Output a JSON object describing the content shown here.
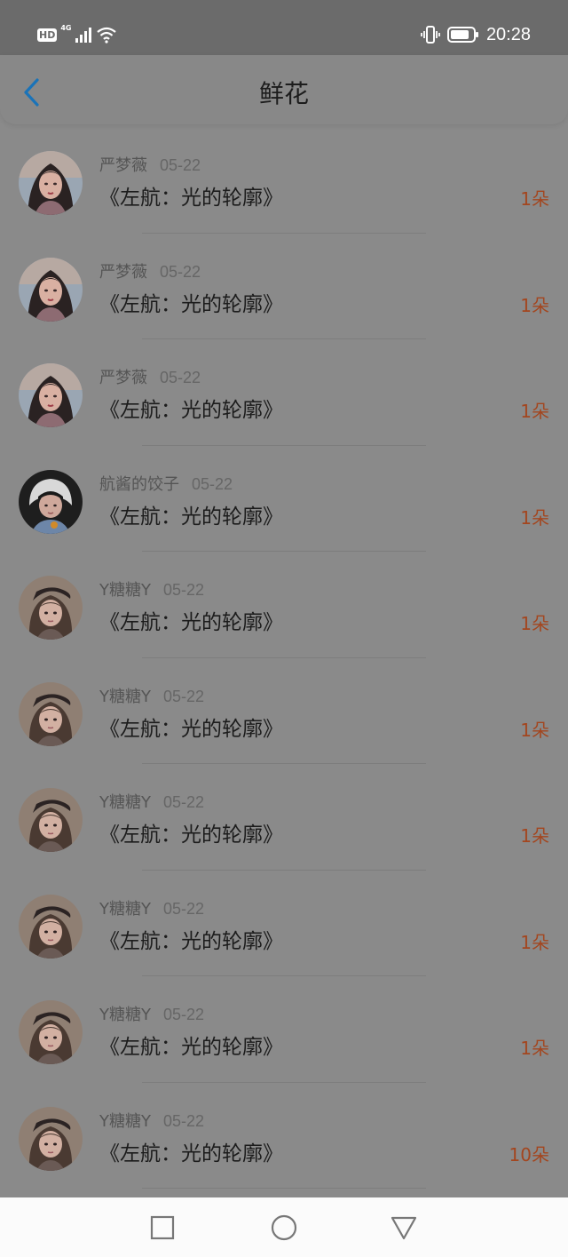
{
  "status_bar": {
    "hd_badge": "HD",
    "network": "4G",
    "time": "20:28",
    "icons": [
      "signal-icon",
      "wifi-icon",
      "vibrate-icon",
      "battery-icon"
    ]
  },
  "header": {
    "title": "鲜花",
    "back_icon": "chevron-left-icon"
  },
  "items": [
    {
      "user": "严梦薇",
      "date": "05-22",
      "title": "《左航：光的轮廓》",
      "amount": "1朵",
      "avatar": "girl-a"
    },
    {
      "user": "严梦薇",
      "date": "05-22",
      "title": "《左航：光的轮廓》",
      "amount": "1朵",
      "avatar": "girl-a"
    },
    {
      "user": "严梦薇",
      "date": "05-22",
      "title": "《左航：光的轮廓》",
      "amount": "1朵",
      "avatar": "girl-a"
    },
    {
      "user": "航酱的饺子",
      "date": "05-22",
      "title": "《左航：光的轮廓》",
      "amount": "1朵",
      "avatar": "boy"
    },
    {
      "user": "Y糖糖Y",
      "date": "05-22",
      "title": "《左航：光的轮廓》",
      "amount": "1朵",
      "avatar": "girl-b"
    },
    {
      "user": "Y糖糖Y",
      "date": "05-22",
      "title": "《左航：光的轮廓》",
      "amount": "1朵",
      "avatar": "girl-b"
    },
    {
      "user": "Y糖糖Y",
      "date": "05-22",
      "title": "《左航：光的轮廓》",
      "amount": "1朵",
      "avatar": "girl-b"
    },
    {
      "user": "Y糖糖Y",
      "date": "05-22",
      "title": "《左航：光的轮廓》",
      "amount": "1朵",
      "avatar": "girl-b"
    },
    {
      "user": "Y糖糖Y",
      "date": "05-22",
      "title": "《左航：光的轮廓》",
      "amount": "1朵",
      "avatar": "girl-b"
    },
    {
      "user": "Y糖糖Y",
      "date": "05-22",
      "title": "《左航：光的轮廓》",
      "amount": "10朵",
      "avatar": "girl-b"
    }
  ],
  "system_nav": {
    "icons": [
      "recent-apps-icon",
      "home-icon",
      "back-triangle-icon"
    ]
  },
  "colors": {
    "accent": "#1a73b8",
    "amount": "#a3461f",
    "overlay_bg": "#8a8a8a"
  }
}
